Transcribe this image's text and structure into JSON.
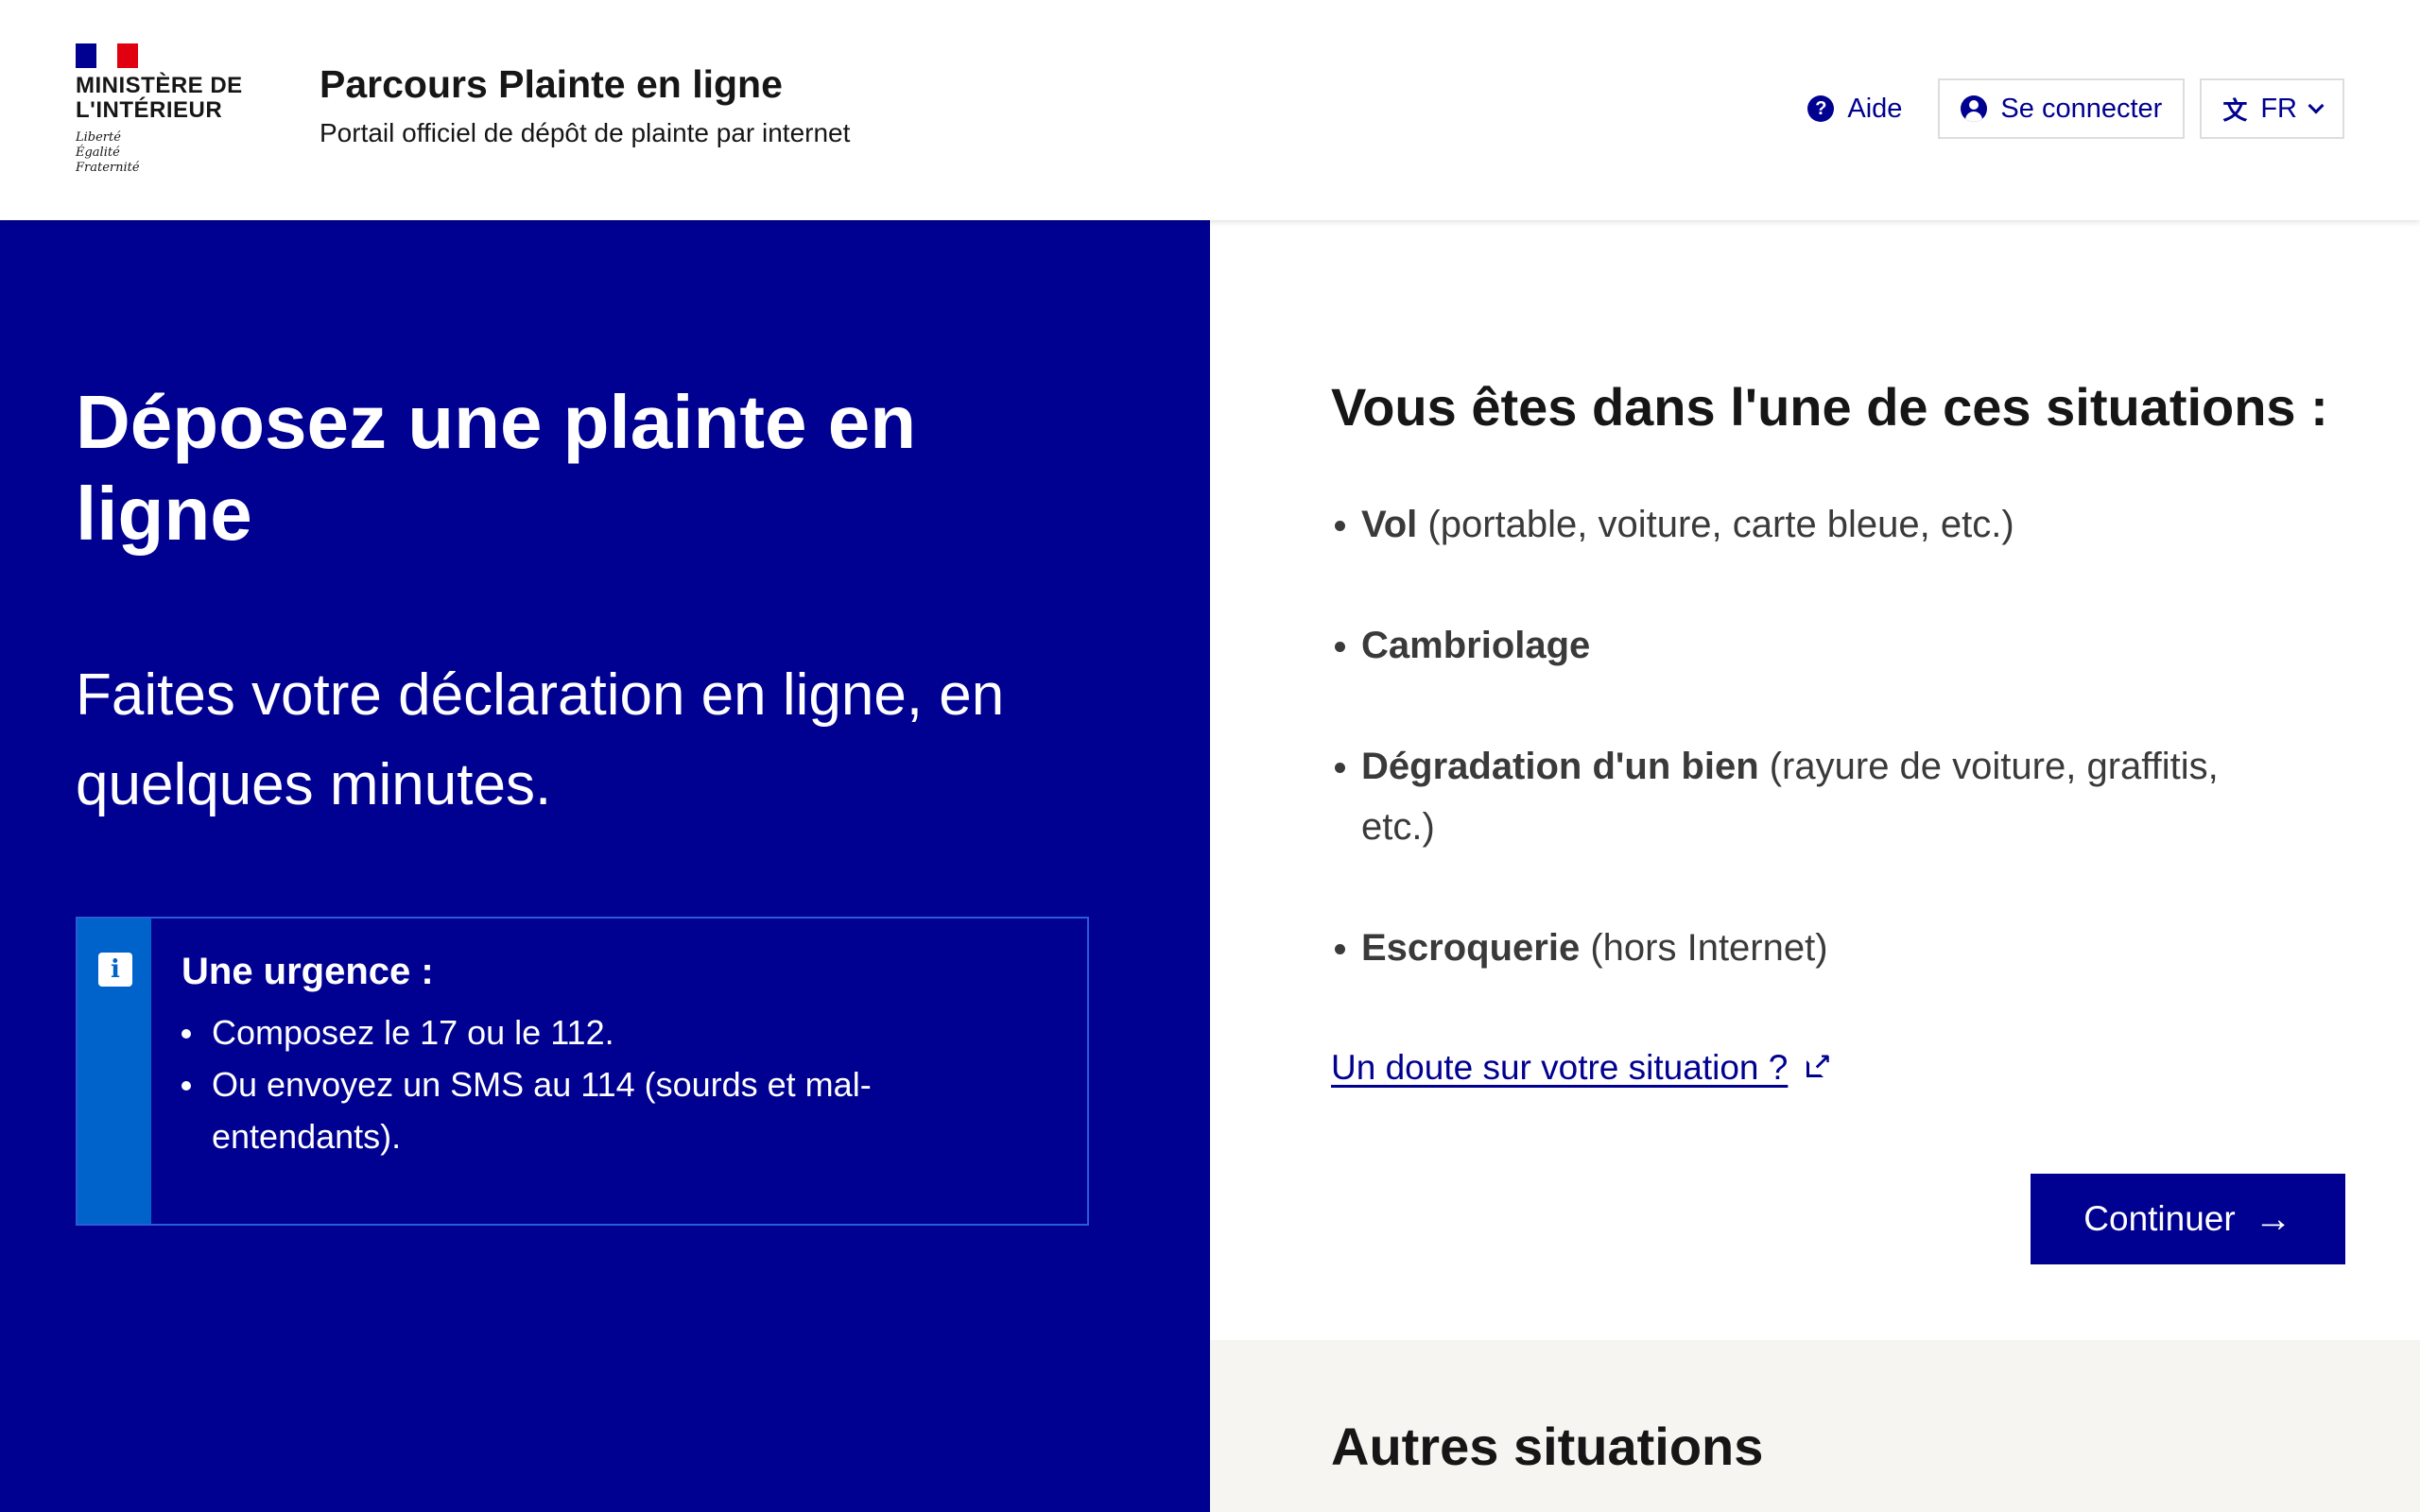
{
  "header": {
    "ministry": "Ministère de l'Intérieur",
    "motto": [
      "Liberté",
      "Égalité",
      "Fraternité"
    ],
    "flag_colors": [
      "#000091",
      "#ffffff",
      "#e1000f"
    ],
    "site_title": "Parcours Plainte en ligne",
    "site_tagline": "Portail officiel de dépôt de plainte par internet",
    "help_label": "Aide",
    "help_icon": "question-circle-icon",
    "login_label": "Se connecter",
    "login_icon": "user-circle-icon",
    "language_label": "FR",
    "language_icon": "translate-icon"
  },
  "hero": {
    "title": "Déposez une plainte en ligne",
    "subtitle": "Faites votre déclaration en ligne, en quelques minutes.",
    "background": "#000091",
    "callout": {
      "title": "Une urgence :",
      "icon": "info-icon",
      "items": [
        "Composez le 17 ou le 112.",
        "Ou envoyez un SMS au 114 (sourds et mal-entendants)."
      ]
    }
  },
  "situations": {
    "title": "Vous êtes dans l'une de ces situations :",
    "items": [
      {
        "strong": "Vol",
        "rest": " (portable, voiture, carte bleue, etc.)"
      },
      {
        "strong": "Cambriolage",
        "rest": ""
      },
      {
        "strong": "Dégradation d'un bien",
        "rest": " (rayure de voiture, graffitis, etc.)"
      },
      {
        "strong": "Escroquerie",
        "rest": " (hors Internet)"
      }
    ],
    "doubt_link": "Un doute sur votre situation ?",
    "continue_label": "Continuer"
  },
  "other": {
    "title": "Autres situations"
  }
}
